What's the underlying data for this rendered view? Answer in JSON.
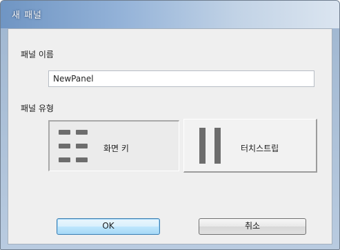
{
  "window": {
    "title": "새 패널"
  },
  "panel_name": {
    "label": "패널 이름",
    "value": "NewPanel"
  },
  "panel_type": {
    "label": "패널 유형",
    "options": [
      {
        "label": "화면 키",
        "icon": "grid-keys-icon",
        "selected": true
      },
      {
        "label": "터치스트립",
        "icon": "touch-strip-icon",
        "selected": false
      }
    ]
  },
  "buttons": {
    "ok": "OK",
    "cancel": "취소"
  }
}
